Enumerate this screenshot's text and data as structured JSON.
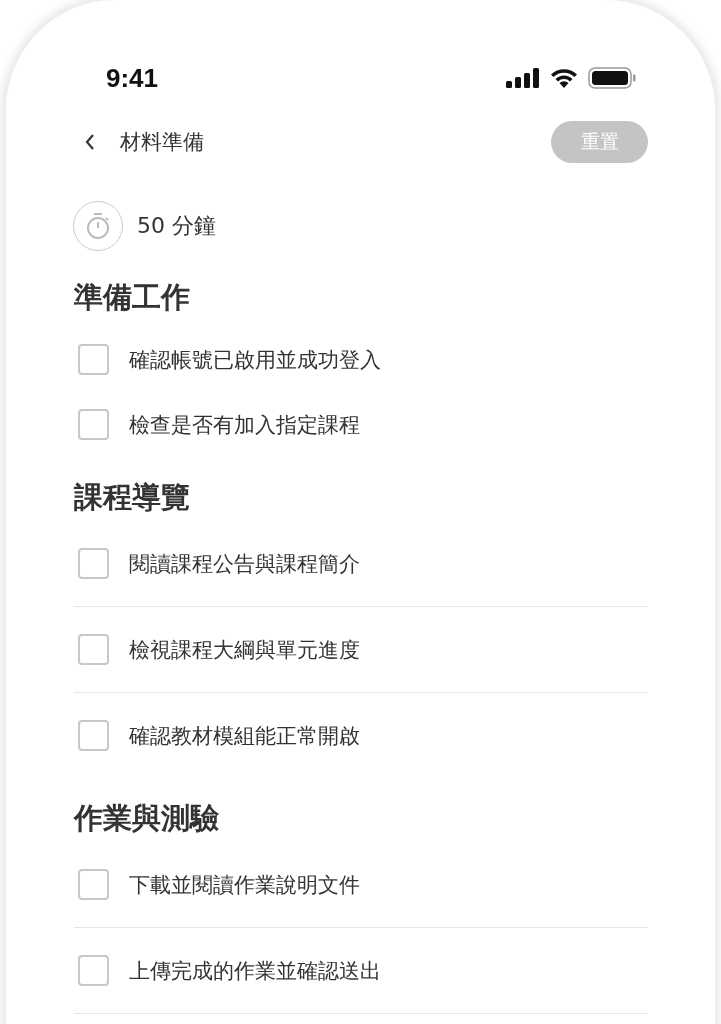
{
  "status_bar": {
    "time": "9:41"
  },
  "header": {
    "title": "材料準備",
    "reset_button": {
      "label": "重置",
      "disabled": true
    }
  },
  "duration": "50 分鐘",
  "sections": [
    {
      "title": "準備工作",
      "kind": "plain",
      "items": [
        {
          "label": "確認帳號已啟用並成功登入",
          "checked": false,
          "divider_below": false
        },
        {
          "label": "檢查是否有加入指定課程",
          "checked": false,
          "divider_below": false
        }
      ]
    },
    {
      "title": "課程導覽",
      "kind": "divided",
      "items": [
        {
          "label": "閱讀課程公告與課程簡介",
          "checked": false,
          "divider_below": true
        },
        {
          "label": "檢視課程大綱與單元進度",
          "checked": false,
          "divider_below": true
        },
        {
          "label": "確認教材模組能正常開啟",
          "checked": false,
          "divider_below": false
        }
      ]
    },
    {
      "title": "作業與測驗",
      "kind": "divided",
      "items": [
        {
          "label": "下載並閱讀作業說明文件",
          "checked": false,
          "divider_below": true
        },
        {
          "label": "上傳完成的作業並確認送出",
          "checked": false,
          "divider_below": true
        }
      ]
    }
  ]
}
